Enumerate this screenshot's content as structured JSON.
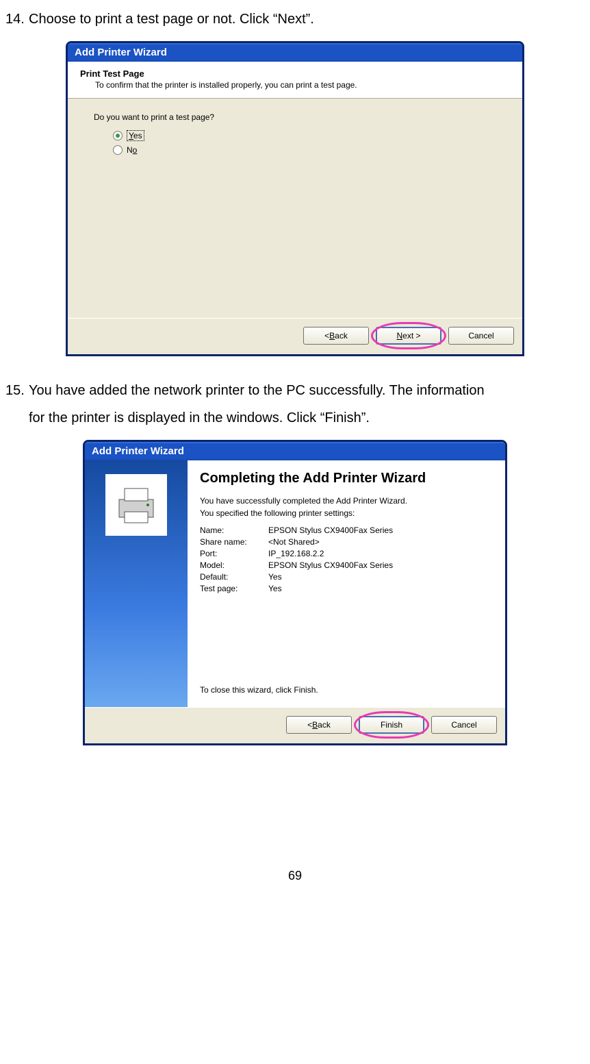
{
  "step14": {
    "num": "14.",
    "text": "Choose to print a test page or not. Click “Next”."
  },
  "step15": {
    "num": "15.",
    "line1": "You have added the network printer to the PC successfully. The information",
    "line2": "for the printer is displayed in the windows. Click “Finish”."
  },
  "dialog1": {
    "title": "Add Printer Wizard",
    "header_title": "Print Test Page",
    "header_sub": "To confirm that the printer is installed properly, you can print a test page.",
    "prompt": "Do you want to print a test page?",
    "yes_underline": "Y",
    "yes_rest": "es",
    "no_underline": "o",
    "no_prefix": "N",
    "back_u": "B",
    "back_rest": "ack",
    "back_prefix": "< ",
    "next_u": "N",
    "next_rest": "ext >",
    "cancel": "Cancel"
  },
  "dialog2": {
    "title": "Add Printer Wizard",
    "finish_title": "Completing the Add Printer Wizard",
    "msg1": "You have successfully completed the Add Printer Wizard.",
    "msg2": "You specified the following printer settings:",
    "info": [
      {
        "label": "Name:",
        "value": "EPSON Stylus CX9400Fax Series"
      },
      {
        "label": "Share name:",
        "value": "<Not Shared>"
      },
      {
        "label": "Port:",
        "value": "IP_192.168.2.2"
      },
      {
        "label": "Model:",
        "value": "EPSON Stylus CX9400Fax Series"
      },
      {
        "label": "Default:",
        "value": "Yes"
      },
      {
        "label": "Test page:",
        "value": "Yes"
      }
    ],
    "close_msg": "To close this wizard, click Finish.",
    "back_u": "B",
    "back_rest": "ack",
    "back_prefix": "< ",
    "finish": "Finish",
    "cancel": "Cancel"
  },
  "page_number": "69"
}
